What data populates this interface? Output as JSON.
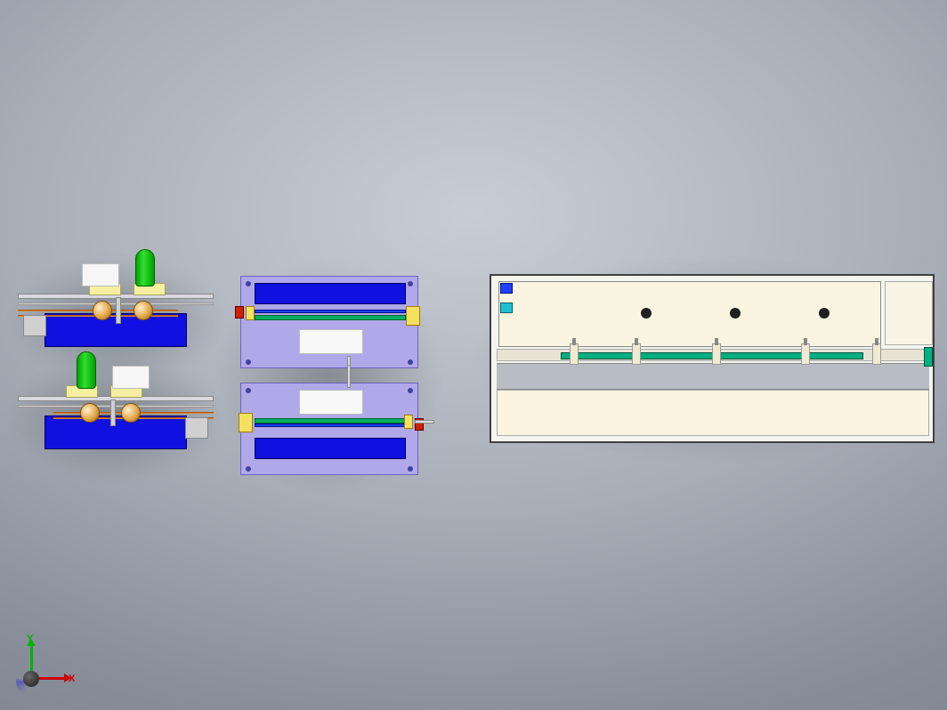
{
  "axes": {
    "x_label": "X",
    "y_label": "Y"
  },
  "colors": {
    "blue_plate": "#1010e0",
    "lilac_base": "#b0a8e8",
    "green_cyl": "#30e030",
    "green_beam": "#00b060",
    "teal_beam": "#00b080",
    "yellow_block": "#f5f0a0",
    "yellow_clip": "#f5e060",
    "orange_rod": "#d88820",
    "red_block": "#d02000",
    "cream_panel": "#faf5e0",
    "grey_strip": "#b8bcc4"
  },
  "assemblies": {
    "small_front": [
      {
        "id": "upper",
        "mirror": false,
        "white_block_side": "left",
        "green_cyl_side": "right",
        "motor_side": "left"
      },
      {
        "id": "lower",
        "mirror": true,
        "white_block_side": "right",
        "green_cyl_side": "left",
        "motor_side": "right"
      }
    ],
    "mid_top": [
      {
        "id": "upper",
        "blue_panel_edge": "top",
        "white_panel_pos": "bottom-center",
        "red_block_side": "left",
        "clip_side": "right"
      },
      {
        "id": "lower",
        "blue_panel_edge": "bottom",
        "white_panel_pos": "top-center",
        "red_block_side": "right",
        "clip_side": "left"
      }
    ],
    "large_panel": {
      "holes_x": [
        170,
        270,
        370
      ],
      "brackets_x": [
        90,
        160,
        250,
        350,
        430
      ],
      "mid_beam": "green",
      "square_indicators": [
        "blue",
        "cyan"
      ]
    }
  }
}
